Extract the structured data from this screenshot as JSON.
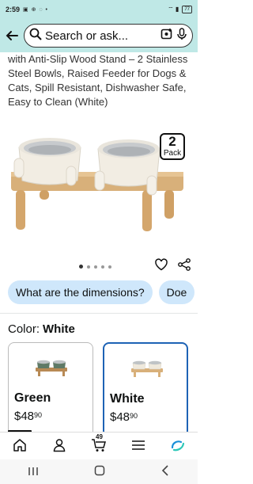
{
  "status_bar": {
    "time": "2:59",
    "status_icons": "▣ ⊕ ◌ •",
    "signal": "⌔ ▮",
    "battery": "77"
  },
  "search": {
    "placeholder": "Search or ask..."
  },
  "product": {
    "title": "with Anti-Slip Wood Stand – 2 Stainless Steel Bowls, Raised Feeder for Dogs & Cats, Spill Resistant, Dishwasher Safe, Easy to Clean (White)",
    "pack_count": "2",
    "pack_label": "Pack"
  },
  "question_chips": [
    "What are the dimensions?",
    "Doe"
  ],
  "color": {
    "label": "Color:",
    "selected": "White"
  },
  "swatches": [
    {
      "name": "Green",
      "currency": "$",
      "price_whole": "48",
      "price_fraction": "90"
    },
    {
      "name": "White",
      "currency": "$",
      "price_whole": "48",
      "price_fraction": "90"
    }
  ],
  "bottom_nav": {
    "cart_count": "49"
  },
  "colors": {
    "header_bg": "#bfe8e6",
    "chip_bg": "#cfe7fb",
    "selected_border": "#1e63b5"
  }
}
